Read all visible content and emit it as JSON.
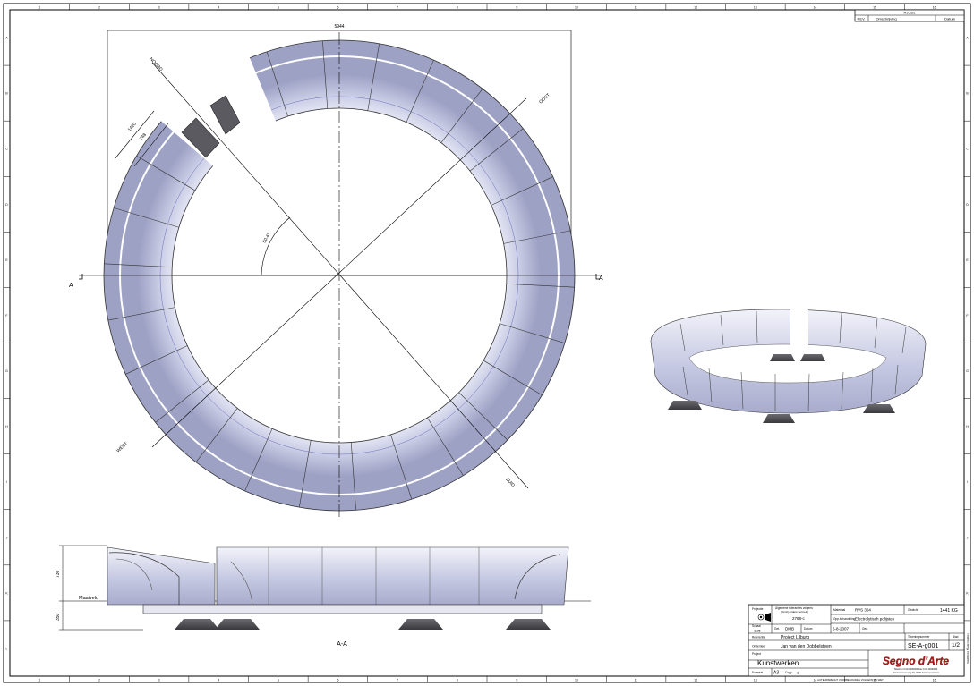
{
  "border": {
    "col_numbers": [
      "1",
      "2",
      "3",
      "4",
      "5",
      "6",
      "7",
      "8",
      "9",
      "10",
      "11",
      "12",
      "13",
      "14",
      "15",
      "16"
    ],
    "row_letters": [
      "A",
      "B",
      "C",
      "D",
      "E",
      "F",
      "G",
      "H",
      "I",
      "J",
      "K",
      "L"
    ]
  },
  "revision_table": {
    "title": "Revisie",
    "col_rev": "REV.",
    "col_desc": "Omschrijving",
    "col_date": "Datum"
  },
  "plan_view": {
    "dimension_overall": "5944",
    "dimension_width": "1420",
    "dimension_inner": "748",
    "angle": "50.4°",
    "north": "NOORD",
    "east": "OOST",
    "south": "ZUID",
    "west": "WEST",
    "section_left": "A",
    "section_right": "A"
  },
  "section_view": {
    "height_top": "730",
    "height_bottom": "350",
    "ground_label": "Maaiveld",
    "caption": "A-A"
  },
  "title_block": {
    "projection_label": "Projectie",
    "scale_label": "Schaal",
    "scale": "1:25",
    "tolerance_label": "Algemene toleranties volgens",
    "tolerance_sub": "(Tenzij anders vermeld)",
    "tolerance_value": "2768-c",
    "material_label": "Materiaal",
    "material_value": "RVS 304",
    "finish_label": "Opp.behandeling",
    "finish_value": "Electrolytisch polijsten",
    "weight_label": "Gewicht",
    "weight_value": "1441 KG",
    "drawn_label": "Get.",
    "drawn_value": "DMB",
    "date_label": "Datum",
    "date_value": "6-8-2007",
    "checked_label": "Gec.",
    "format_a_label": "Blad",
    "sheet_label": "Blad",
    "sheet_value": "1/2",
    "reference_label": "Referentie",
    "reference_value": "Project Lilburg",
    "subject_label": "Onderdeel",
    "subject_value": "Jan van den Dobbelsteen",
    "drawing_no_label": "Tekeningnummer",
    "drawing_no_value": "SE-A-g001",
    "project_label": "Project",
    "project_value": "Kunstwerken",
    "format_label": "Formaat",
    "format_value": "A3",
    "copy_label": "Copy",
    "copy_value": "1",
    "logo": "Segno d'Arte",
    "contact1": "Telefoon 0 00-0000000 Fax 0 00-0000000",
    "contact2": "Amsterdamseweg 00, 0000 AA Groenestraat",
    "copyright": "AUTEURSRECHT VOORBEHOUDEN VOLGENS DE WET",
    "side_note": "SolidWorks Student Edition"
  }
}
